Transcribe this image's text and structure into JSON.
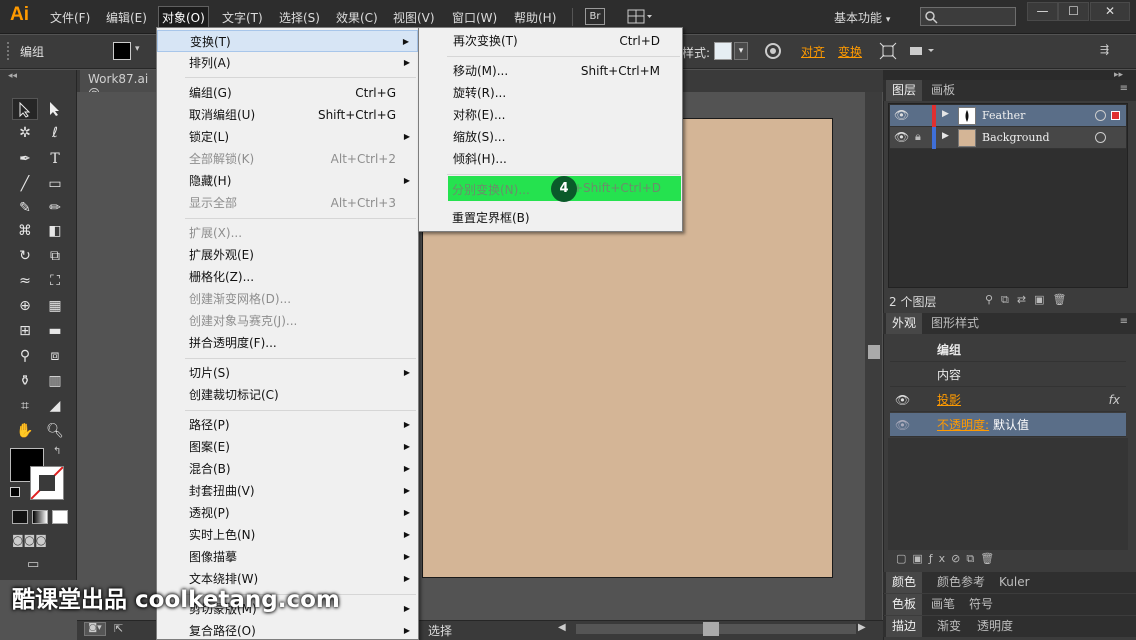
{
  "app": {
    "logo": "Ai",
    "workspace": "基本功能"
  },
  "menubar": {
    "items": [
      "文件(F)",
      "编辑(E)",
      "对象(O)",
      "文字(T)",
      "选择(S)",
      "效果(C)",
      "视图(V)",
      "窗口(W)",
      "帮助(H)"
    ],
    "br": "Br"
  },
  "controlbar": {
    "label": "编组",
    "style_label": "样式:",
    "align": "对齐",
    "transform": "变换"
  },
  "document": {
    "tab": "Work87.ai @"
  },
  "object_menu": {
    "items": [
      {
        "label": "变换(T)",
        "arrow": true
      },
      {
        "label": "排列(A)",
        "arrow": true
      },
      {
        "label": "编组(G)",
        "shortcut": "Ctrl+G"
      },
      {
        "label": "取消编组(U)",
        "shortcut": "Shift+Ctrl+G"
      },
      {
        "label": "锁定(L)",
        "arrow": true
      },
      {
        "label": "全部解锁(K)",
        "shortcut": "Alt+Ctrl+2",
        "disabled": true
      },
      {
        "label": "隐藏(H)",
        "arrow": true
      },
      {
        "label": "显示全部",
        "shortcut": "Alt+Ctrl+3",
        "disabled": true
      },
      {
        "label": "扩展(X)...",
        "disabled": true
      },
      {
        "label": "扩展外观(E)"
      },
      {
        "label": "栅格化(Z)..."
      },
      {
        "label": "创建渐变网格(D)...",
        "disabled": true
      },
      {
        "label": "创建对象马赛克(J)...",
        "disabled": true
      },
      {
        "label": "拼合透明度(F)..."
      },
      {
        "label": "切片(S)",
        "arrow": true
      },
      {
        "label": "创建裁切标记(C)"
      },
      {
        "label": "路径(P)",
        "arrow": true
      },
      {
        "label": "图案(E)",
        "arrow": true
      },
      {
        "label": "混合(B)",
        "arrow": true
      },
      {
        "label": "封套扭曲(V)",
        "arrow": true
      },
      {
        "label": "透视(P)",
        "arrow": true
      },
      {
        "label": "实时上色(N)",
        "arrow": true
      },
      {
        "label": "图像描摹",
        "arrow": true
      },
      {
        "label": "文本绕排(W)",
        "arrow": true
      },
      {
        "label": "剪切蒙版(M)",
        "arrow": true
      },
      {
        "label": "复合路径(O)",
        "arrow": true
      }
    ]
  },
  "transform_menu": {
    "items": [
      {
        "label": "再次变换(T)",
        "shortcut": "Ctrl+D"
      },
      {
        "label": "移动(M)...",
        "shortcut": "Shift+Ctrl+M"
      },
      {
        "label": "旋转(R)..."
      },
      {
        "label": "对称(E)..."
      },
      {
        "label": "缩放(S)..."
      },
      {
        "label": "倾斜(H)..."
      },
      {
        "label": "分别变换(N)...",
        "shortcut": "Alt+Shift+Ctrl+D"
      },
      {
        "label": "重置定界框(B)"
      }
    ]
  },
  "step_badge": "4",
  "layers": {
    "tabs": [
      "图层",
      "画板"
    ],
    "rows": [
      "Feather",
      "Background"
    ],
    "count": "2 个图层"
  },
  "appearance": {
    "tabs": [
      "外观",
      "图形样式"
    ],
    "group": "编组",
    "content": "内容",
    "shadow": "投影",
    "opacity_label": "不透明度:",
    "opacity_value": "默认值",
    "fx": "fx"
  },
  "bottom_panels": {
    "row1": [
      "颜色",
      "颜色参考",
      "Kuler"
    ],
    "row2": [
      "色板",
      "画笔",
      "符号"
    ],
    "row3": [
      "描边",
      "渐变",
      "透明度"
    ]
  },
  "status": {
    "tool": "选择"
  },
  "watermark": "酷课堂出品 coolketang.com",
  "colors": {
    "accent": "#ff9a00",
    "highlight_green": "#25e24f",
    "artboard": "#d4b596"
  }
}
